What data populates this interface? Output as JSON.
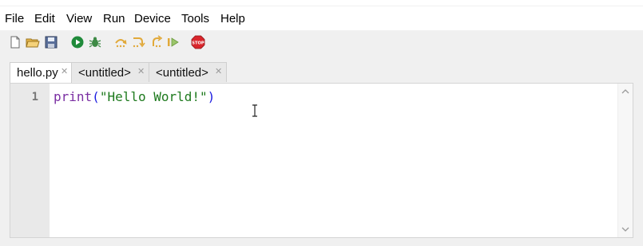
{
  "menu": {
    "items": [
      {
        "label": "File"
      },
      {
        "label": "Edit"
      },
      {
        "label": "View"
      },
      {
        "label": "Run"
      },
      {
        "label": "Device"
      },
      {
        "label": "Tools"
      },
      {
        "label": "Help"
      }
    ]
  },
  "toolbar": {
    "buttons": [
      {
        "icon": "new-file-icon"
      },
      {
        "icon": "open-folder-icon"
      },
      {
        "icon": "save-icon"
      },
      {
        "icon": "run-icon"
      },
      {
        "icon": "debug-bug-icon"
      },
      {
        "icon": "step-over-icon"
      },
      {
        "icon": "step-into-icon"
      },
      {
        "icon": "step-out-icon"
      },
      {
        "icon": "resume-icon"
      },
      {
        "icon": "stop-icon",
        "text": "STOP"
      }
    ]
  },
  "tabs": [
    {
      "label": "hello.py",
      "active": true
    },
    {
      "label": "<untitled>",
      "active": false
    },
    {
      "label": "<untitled>",
      "active": false
    }
  ],
  "editor": {
    "line_number": "1",
    "code": {
      "func": "print",
      "open_paren": "(",
      "string": "\"Hello World!\"",
      "close_paren": ")"
    }
  },
  "colors": {
    "func": "#7a2ea2",
    "paren": "#1c1ce0",
    "string": "#1e7a1e",
    "stop_red": "#d9262c",
    "run_green": "#1f8a3a"
  }
}
